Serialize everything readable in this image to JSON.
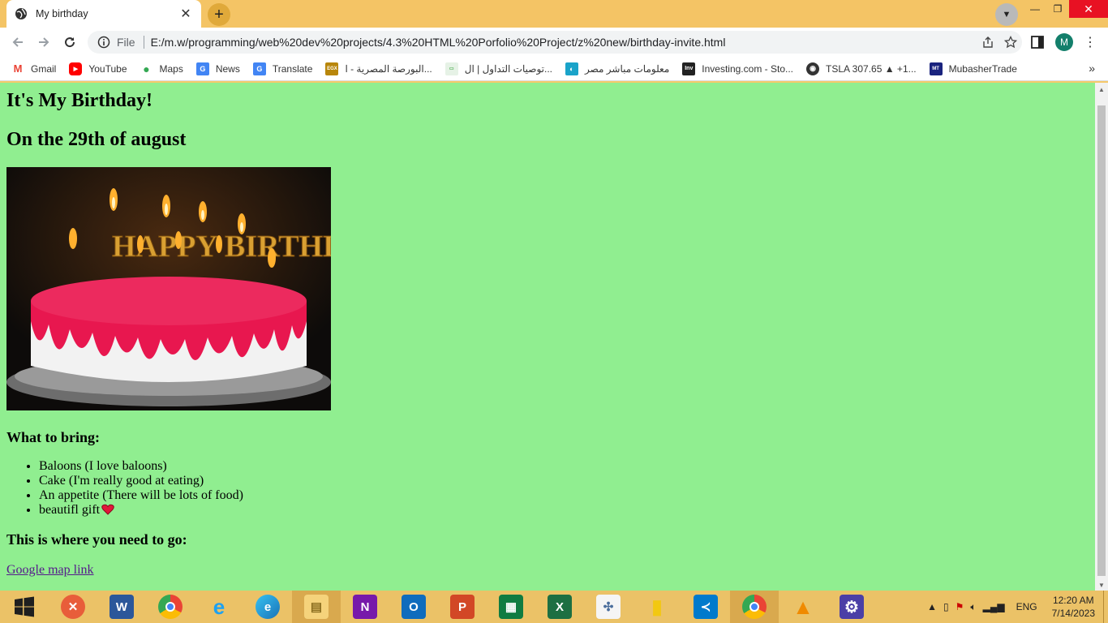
{
  "browser": {
    "tab_title": "My birthday",
    "url_scheme": "File",
    "url": "E:/m.w/programming/web%20dev%20projects/4.3%20HTML%20Porfolio%20Project/z%20new/birthday-invite.html",
    "profile_initial": "M"
  },
  "bookmarks": [
    {
      "label": "Gmail",
      "icon": "gmail-icon"
    },
    {
      "label": "YouTube",
      "icon": "youtube-icon"
    },
    {
      "label": "Maps",
      "icon": "maps-icon"
    },
    {
      "label": "News",
      "icon": "news-icon"
    },
    {
      "label": "Translate",
      "icon": "translate-icon"
    },
    {
      "label": "البورصة المصرية - ا...",
      "icon": "egx-icon"
    },
    {
      "label": "توصيات التداول | ال...",
      "icon": "site-icon"
    },
    {
      "label": "معلومات مباشر مصر",
      "icon": "mubasher-icon"
    },
    {
      "label": "Investing.com - Sto...",
      "icon": "investing-icon"
    },
    {
      "label": "TSLA 307.65 ▲ +1...",
      "icon": "globe-icon"
    },
    {
      "label": "MubasherTrade",
      "icon": "mubashertrade-icon"
    }
  ],
  "page": {
    "heading": "It's My Birthday!",
    "date": "On the 29th of august",
    "cake_image_alt": "HAPPY BIRTHDAY",
    "bring_heading": "What to bring:",
    "bring_items": [
      "Baloons (I love baloons)",
      "Cake (I'm really good at eating)",
      "An appetite (There will be lots of food)",
      "beautifl gift"
    ],
    "go_heading": "This is where you need to go:",
    "map_link": "Google map link"
  },
  "taskbar": {
    "apps": [
      "start",
      "x-app",
      "word",
      "chrome",
      "internet-explorer",
      "edge",
      "file-explorer",
      "onenote",
      "outlook",
      "powerpoint",
      "project",
      "excel",
      "tableau",
      "power-bi",
      "vscode",
      "chrome-profile",
      "vlc",
      "settings"
    ],
    "language": "ENG",
    "time": "12:20 AM",
    "date": "7/14/2023"
  },
  "colors": {
    "page_background": "#90ee90",
    "tabstrip": "#f4c465",
    "taskbar": "#ebc267",
    "link": "#551a8b"
  }
}
